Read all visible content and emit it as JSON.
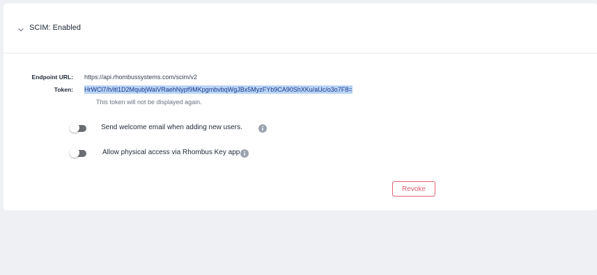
{
  "section": {
    "title": "SCIM: Enabled"
  },
  "endpoint": {
    "label": "Endpoint URL:",
    "value": "https://api.rhombussystems.com/scim/v2"
  },
  "token": {
    "label": "Token:",
    "value": "HrWCl7/h/itl1D2MqubjWaiVRaehNypf9MKpgmbvbqWgJBx5MyzFYb9CA90ShXKu/aUc/o3o7F8=",
    "note": "This token will not be displayed again."
  },
  "toggles": [
    {
      "label": "Send welcome email when adding new users.",
      "state": "off",
      "icon": "info-icon"
    },
    {
      "label": "Allow physical access via Rhombus Key app",
      "state": "off",
      "icon": "info-icon"
    }
  ],
  "actions": {
    "revoke_label": "Revoke"
  },
  "colors": {
    "danger": "#e15e72",
    "token_highlight": "#b8d4f5",
    "toggle_off": "#6b6f74",
    "info_icon": "#9ca3af"
  }
}
